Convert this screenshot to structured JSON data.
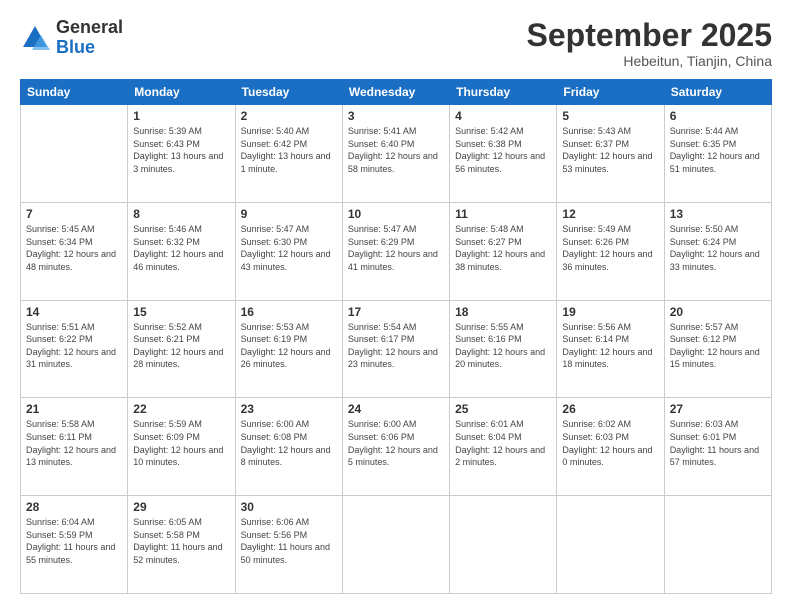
{
  "logo": {
    "general": "General",
    "blue": "Blue"
  },
  "header": {
    "month": "September 2025",
    "location": "Hebeitun, Tianjin, China"
  },
  "weekdays": [
    "Sunday",
    "Monday",
    "Tuesday",
    "Wednesday",
    "Thursday",
    "Friday",
    "Saturday"
  ],
  "weeks": [
    [
      {
        "day": null
      },
      {
        "day": 1,
        "sunrise": "5:39 AM",
        "sunset": "6:43 PM",
        "daylight": "13 hours and 3 minutes."
      },
      {
        "day": 2,
        "sunrise": "5:40 AM",
        "sunset": "6:42 PM",
        "daylight": "13 hours and 1 minute."
      },
      {
        "day": 3,
        "sunrise": "5:41 AM",
        "sunset": "6:40 PM",
        "daylight": "12 hours and 58 minutes."
      },
      {
        "day": 4,
        "sunrise": "5:42 AM",
        "sunset": "6:38 PM",
        "daylight": "12 hours and 56 minutes."
      },
      {
        "day": 5,
        "sunrise": "5:43 AM",
        "sunset": "6:37 PM",
        "daylight": "12 hours and 53 minutes."
      },
      {
        "day": 6,
        "sunrise": "5:44 AM",
        "sunset": "6:35 PM",
        "daylight": "12 hours and 51 minutes."
      }
    ],
    [
      {
        "day": 7,
        "sunrise": "5:45 AM",
        "sunset": "6:34 PM",
        "daylight": "12 hours and 48 minutes."
      },
      {
        "day": 8,
        "sunrise": "5:46 AM",
        "sunset": "6:32 PM",
        "daylight": "12 hours and 46 minutes."
      },
      {
        "day": 9,
        "sunrise": "5:47 AM",
        "sunset": "6:30 PM",
        "daylight": "12 hours and 43 minutes."
      },
      {
        "day": 10,
        "sunrise": "5:47 AM",
        "sunset": "6:29 PM",
        "daylight": "12 hours and 41 minutes."
      },
      {
        "day": 11,
        "sunrise": "5:48 AM",
        "sunset": "6:27 PM",
        "daylight": "12 hours and 38 minutes."
      },
      {
        "day": 12,
        "sunrise": "5:49 AM",
        "sunset": "6:26 PM",
        "daylight": "12 hours and 36 minutes."
      },
      {
        "day": 13,
        "sunrise": "5:50 AM",
        "sunset": "6:24 PM",
        "daylight": "12 hours and 33 minutes."
      }
    ],
    [
      {
        "day": 14,
        "sunrise": "5:51 AM",
        "sunset": "6:22 PM",
        "daylight": "12 hours and 31 minutes."
      },
      {
        "day": 15,
        "sunrise": "5:52 AM",
        "sunset": "6:21 PM",
        "daylight": "12 hours and 28 minutes."
      },
      {
        "day": 16,
        "sunrise": "5:53 AM",
        "sunset": "6:19 PM",
        "daylight": "12 hours and 26 minutes."
      },
      {
        "day": 17,
        "sunrise": "5:54 AM",
        "sunset": "6:17 PM",
        "daylight": "12 hours and 23 minutes."
      },
      {
        "day": 18,
        "sunrise": "5:55 AM",
        "sunset": "6:16 PM",
        "daylight": "12 hours and 20 minutes."
      },
      {
        "day": 19,
        "sunrise": "5:56 AM",
        "sunset": "6:14 PM",
        "daylight": "12 hours and 18 minutes."
      },
      {
        "day": 20,
        "sunrise": "5:57 AM",
        "sunset": "6:12 PM",
        "daylight": "12 hours and 15 minutes."
      }
    ],
    [
      {
        "day": 21,
        "sunrise": "5:58 AM",
        "sunset": "6:11 PM",
        "daylight": "12 hours and 13 minutes."
      },
      {
        "day": 22,
        "sunrise": "5:59 AM",
        "sunset": "6:09 PM",
        "daylight": "12 hours and 10 minutes."
      },
      {
        "day": 23,
        "sunrise": "6:00 AM",
        "sunset": "6:08 PM",
        "daylight": "12 hours and 8 minutes."
      },
      {
        "day": 24,
        "sunrise": "6:00 AM",
        "sunset": "6:06 PM",
        "daylight": "12 hours and 5 minutes."
      },
      {
        "day": 25,
        "sunrise": "6:01 AM",
        "sunset": "6:04 PM",
        "daylight": "12 hours and 2 minutes."
      },
      {
        "day": 26,
        "sunrise": "6:02 AM",
        "sunset": "6:03 PM",
        "daylight": "12 hours and 0 minutes."
      },
      {
        "day": 27,
        "sunrise": "6:03 AM",
        "sunset": "6:01 PM",
        "daylight": "11 hours and 57 minutes."
      }
    ],
    [
      {
        "day": 28,
        "sunrise": "6:04 AM",
        "sunset": "5:59 PM",
        "daylight": "11 hours and 55 minutes."
      },
      {
        "day": 29,
        "sunrise": "6:05 AM",
        "sunset": "5:58 PM",
        "daylight": "11 hours and 52 minutes."
      },
      {
        "day": 30,
        "sunrise": "6:06 AM",
        "sunset": "5:56 PM",
        "daylight": "11 hours and 50 minutes."
      },
      {
        "day": null
      },
      {
        "day": null
      },
      {
        "day": null
      },
      {
        "day": null
      }
    ]
  ]
}
